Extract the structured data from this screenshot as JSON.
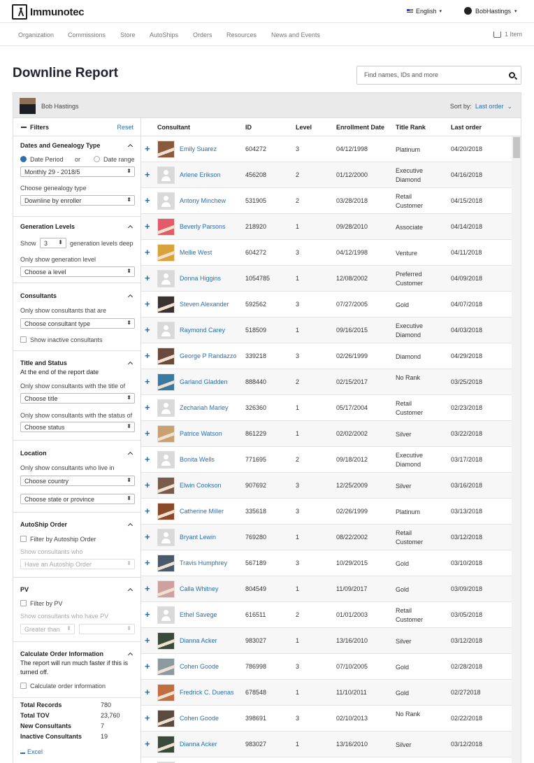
{
  "brand": {
    "name": "Immunotec"
  },
  "header": {
    "language": "English",
    "user": "BobHastings"
  },
  "nav": {
    "items": [
      "Organization",
      "Commissions",
      "Store",
      "AutoShips",
      "Orders",
      "Resources",
      "News and Events"
    ],
    "cart": "1 Item"
  },
  "page": {
    "title": "Downline Report"
  },
  "search": {
    "placeholder": "Find names, IDs and more"
  },
  "report": {
    "owner": "Bob Hastings",
    "sort_label": "Sort by:",
    "sort_value": "Last order"
  },
  "filters": {
    "title": "Filters",
    "reset": "Reset",
    "dates": {
      "title": "Dates and Genealogy Type",
      "option_period": "Date Period",
      "or": "or",
      "option_range": "Date range",
      "period_value": "Monthly 29 - 2018/5",
      "genealogy_label": "Choose genealogy type",
      "genealogy_value": "Downline by enroller"
    },
    "generation": {
      "title": "Generation Levels",
      "show": "Show",
      "levels_value": "3",
      "deep_text": "generation levels deep",
      "only_label": "Only show generation level",
      "level_placeholder": "Choose a level"
    },
    "consultants": {
      "title": "Consultants",
      "only_label": "Only show consultants that are",
      "type_placeholder": "Choose consultant type",
      "inactive_label": "Show inactive consultants"
    },
    "title_status": {
      "title": "Title and Status",
      "subtitle": "At the end of the report date",
      "title_label": "Only show consultants with the title of",
      "title_placeholder": "Choose title",
      "status_label": "Only show consultants with the status of",
      "status_placeholder": "Choose status"
    },
    "location": {
      "title": "Location",
      "label": "Only show consultants who live in",
      "country_placeholder": "Choose country",
      "state_placeholder": "Choose state or province"
    },
    "autoship": {
      "title": "AutoShip Order",
      "filter_label": "Filter by Autoship Order",
      "who_label": "Show consultants who",
      "value": "Have an Autoship Order"
    },
    "pv": {
      "title": "PV",
      "filter_label": "Filter by PV",
      "who_label": "Show consultants who have PV",
      "comparator": "Greater than"
    },
    "calc": {
      "title": "Calculate Order Information",
      "note": "The report will run much faster if this is turned off.",
      "checkbox_label": "Calculate order information"
    }
  },
  "totals": [
    {
      "label": "Total Records",
      "value": "780"
    },
    {
      "label": "Total TOV",
      "value": "23,760"
    },
    {
      "label": "New Consultants",
      "value": "7"
    },
    {
      "label": "Inactive Consultants",
      "value": "19"
    }
  ],
  "excel": "Excel",
  "table": {
    "columns": [
      "Consultant",
      "ID",
      "Level",
      "Enrollment Date",
      "Title Rank",
      "Last order"
    ],
    "rows": [
      {
        "name": "Emily Suarez",
        "id": "604272",
        "level": "3",
        "enrollment": "04/12/1998",
        "rank": "Platinum",
        "last": "04/20/2018",
        "photo": "#8a5a3c"
      },
      {
        "name": "Arlene Erikson",
        "id": "456208",
        "level": "2",
        "enrollment": "01/12/2000",
        "rank": "Executive Diamond",
        "last": "04/16/2018",
        "photo": ""
      },
      {
        "name": "Antony Minchew",
        "id": "531905",
        "level": "2",
        "enrollment": "03/28/2018",
        "rank": "Retail Customer",
        "last": "04/15/2018",
        "photo": ""
      },
      {
        "name": "Beverly Parsons",
        "id": "218920",
        "level": "1",
        "enrollment": "09/28/2010",
        "rank": "Associate",
        "last": "04/14/2018",
        "photo": "#e35a6a"
      },
      {
        "name": "Mellie West",
        "id": "604272",
        "level": "3",
        "enrollment": "04/12/1998",
        "rank": "Venture",
        "last": "04/11/2018",
        "photo": "#d9a23a"
      },
      {
        "name": "Donna Higgins",
        "id": "1054785",
        "level": "1",
        "enrollment": "12/08/2002",
        "rank": "Preferred Customer",
        "last": "04/09/2018",
        "photo": ""
      },
      {
        "name": "Steven Alexander",
        "id": "592562",
        "level": "3",
        "enrollment": "07/27/2005",
        "rank": "Gold",
        "last": "04/07/2018",
        "photo": "#3a3230"
      },
      {
        "name": "Raymond Carey",
        "id": "518509",
        "level": "1",
        "enrollment": "09/16/2015",
        "rank": "Executive Diamond",
        "last": "04/03/2018",
        "photo": ""
      },
      {
        "name": "George P Randazzo",
        "id": "339218",
        "level": "3",
        "enrollment": "02/26/1999",
        "rank": "Diamond",
        "last": "04/29/2018",
        "photo": "#6a4a3a"
      },
      {
        "name": "Garland Gladden",
        "id": "888440",
        "level": "2",
        "enrollment": "02/15/2017",
        "rank": "No Rank",
        "last": "03/25/2018",
        "photo": "#3a7aa0"
      },
      {
        "name": "Zechariah Marley",
        "id": "326360",
        "level": "1",
        "enrollment": "05/17/2004",
        "rank": "Retail Customer",
        "last": "02/23/2018",
        "photo": ""
      },
      {
        "name": "Patrice Watson",
        "id": "861229",
        "level": "1",
        "enrollment": "02/02/2002",
        "rank": "Silver",
        "last": "03/22/2018",
        "photo": "#c9a070"
      },
      {
        "name": "Bonita Wells",
        "id": "771695",
        "level": "2",
        "enrollment": "09/18/2012",
        "rank": "Executive Diamond",
        "last": "03/17/2018",
        "photo": ""
      },
      {
        "name": "Elwin Cookson",
        "id": "907692",
        "level": "3",
        "enrollment": "12/25/2009",
        "rank": "Silver",
        "last": "03/16/2018",
        "photo": "#7a5a4a"
      },
      {
        "name": "Catherine Miller",
        "id": "335618",
        "level": "3",
        "enrollment": "02/26/1999",
        "rank": "Platinum",
        "last": "03/13/2018",
        "photo": "#8a4a2a"
      },
      {
        "name": "Bryant Lewin",
        "id": "769280",
        "level": "1",
        "enrollment": "08/22/2002",
        "rank": "Retail Customer",
        "last": "03/12/2018",
        "photo": ""
      },
      {
        "name": "Travis Humphrey",
        "id": "567189",
        "level": "3",
        "enrollment": "10/29/2015",
        "rank": "Gold",
        "last": "03/10/2018",
        "photo": "#4a5a6a"
      },
      {
        "name": "Calla Whitney",
        "id": "804549",
        "level": "1",
        "enrollment": "11/09/2017",
        "rank": "Gold",
        "last": "03/09/2018",
        "photo": "#d0a0a0"
      },
      {
        "name": "Ethel Savege",
        "id": "616511",
        "level": "2",
        "enrollment": "01/01/2003",
        "rank": "Retail Customer",
        "last": "03/05/2018",
        "photo": ""
      },
      {
        "name": "Dianna Acker",
        "id": "983027",
        "level": "1",
        "enrollment": "13/16/2010",
        "rank": "Silver",
        "last": "03/12/2018",
        "photo": "#3a4a3a"
      },
      {
        "name": "Cohen Goode",
        "id": "786998",
        "level": "3",
        "enrollment": "07/10/2005",
        "rank": "Gold",
        "last": "02/28/2018",
        "photo": "#8a9aa0"
      },
      {
        "name": "Fredrick C. Duenas",
        "id": "678548",
        "level": "1",
        "enrollment": "11/10/2011",
        "rank": "Gold",
        "last": "02/272018",
        "photo": "#c07040"
      },
      {
        "name": "Cohen Goode",
        "id": "398691",
        "level": "3",
        "enrollment": "02/10/2013",
        "rank": "No Rank",
        "last": "02/22/2018",
        "photo": "#5a4a40"
      },
      {
        "name": "Dianna Acker",
        "id": "983027",
        "level": "1",
        "enrollment": "13/16/2010",
        "rank": "Silver",
        "last": "03/12/2018",
        "photo": "#3a4a3a"
      },
      {
        "name": "",
        "id": "",
        "level": "",
        "enrollment": "",
        "rank": "Retail",
        "last": "",
        "photo": ""
      }
    ]
  }
}
